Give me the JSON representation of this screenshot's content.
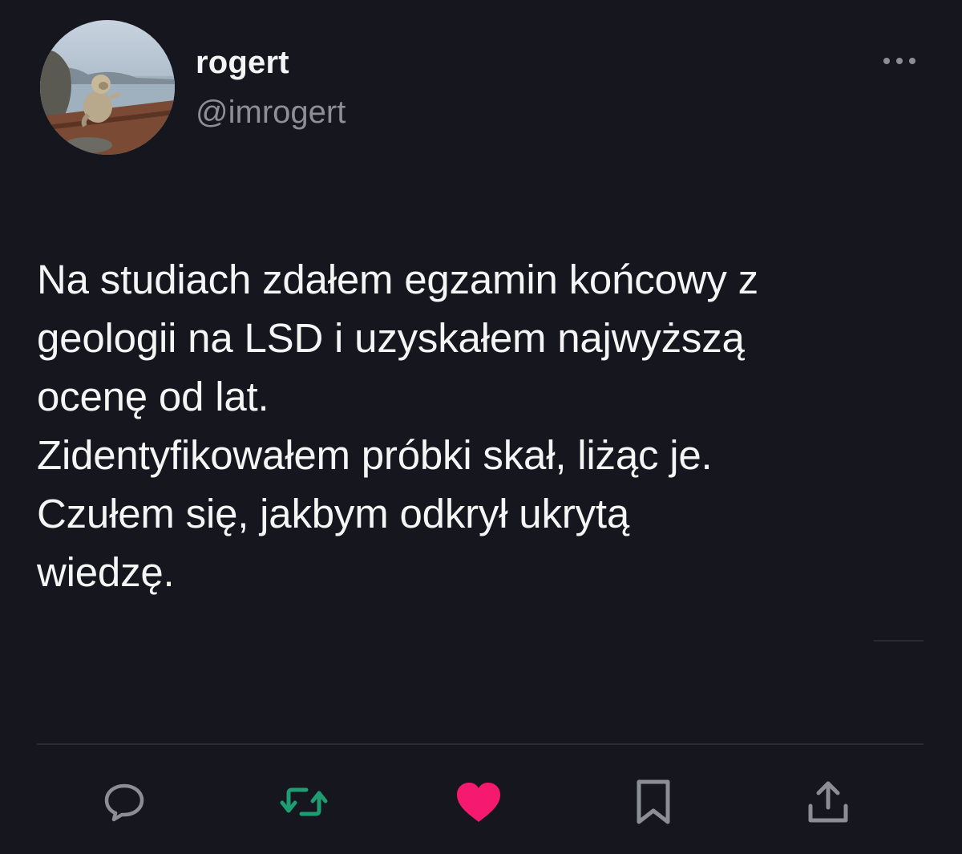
{
  "author": {
    "display_name": "rogert",
    "handle": "@imrogert",
    "avatar_icon": "monkey-on-ledge-photo"
  },
  "tweet": {
    "text": "Na studiach zdałem egzamin końcowy z\ngeologii na LSD i uzyskałem najwyższą\nocenę od lat.\nZidentyfikowałem próbki skał, liżąc je.\nCzułem się, jakbym odkrył ukrytą\nwiedzę."
  },
  "actions": {
    "reply_icon": "reply-bubble-icon",
    "retweet_icon": "retweet-icon",
    "like_icon": "heart-icon",
    "bookmark_icon": "bookmark-icon",
    "share_icon": "share-icon"
  },
  "colors": {
    "background": "#15161e",
    "icon_gray": "#8b8e95",
    "retweet_green": "#1f9d72",
    "like_pink": "#f5196f"
  }
}
